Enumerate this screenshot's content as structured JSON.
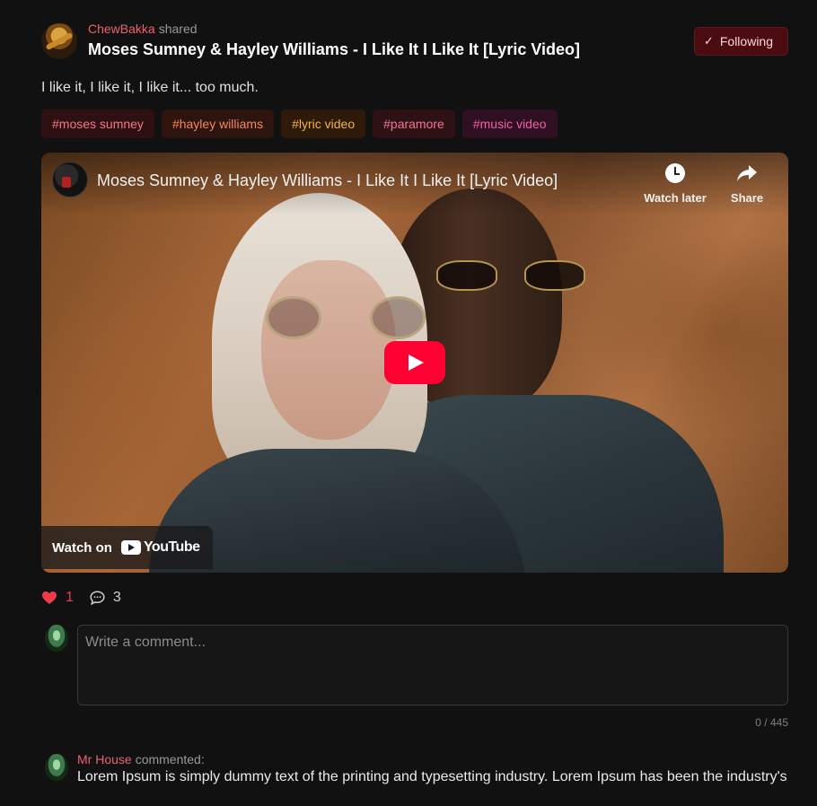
{
  "post": {
    "author": "ChewBakka",
    "shared_label": "shared",
    "title": "Moses Sumney & Hayley Williams - I Like It I Like It [Lyric Video]",
    "follow_label": "Following",
    "text": "I like it, I like it, I like it... too much.",
    "tags": [
      "#moses sumney",
      "#hayley williams",
      "#lyric video",
      "#paramore",
      "#music video"
    ]
  },
  "video": {
    "title": "Moses Sumney & Hayley Williams - I Like It I Like It [Lyric Video]",
    "watch_later_label": "Watch later",
    "share_label": "Share",
    "watch_on_label": "Watch on",
    "youtube_label": "YouTube"
  },
  "actions": {
    "likes": "1",
    "comments": "3"
  },
  "composer": {
    "placeholder": "Write a comment...",
    "char_count": "0 / 445"
  },
  "comments": [
    {
      "author": "Mr House",
      "verb": "commented:",
      "text": "Lorem Ipsum is simply dummy text of the printing and typesetting industry. Lorem Ipsum has been the industry's"
    }
  ],
  "colors": {
    "accent": "#f0606d",
    "like": "#ef3b4a",
    "follow_bg": "#4a0c11",
    "play": "#ff0033"
  },
  "icons": {
    "follow": "check-icon",
    "like": "heart-icon",
    "comment": "comment-bubble-icon",
    "watch_later": "clock-icon",
    "share": "share-arrow-icon",
    "play": "play-icon"
  }
}
